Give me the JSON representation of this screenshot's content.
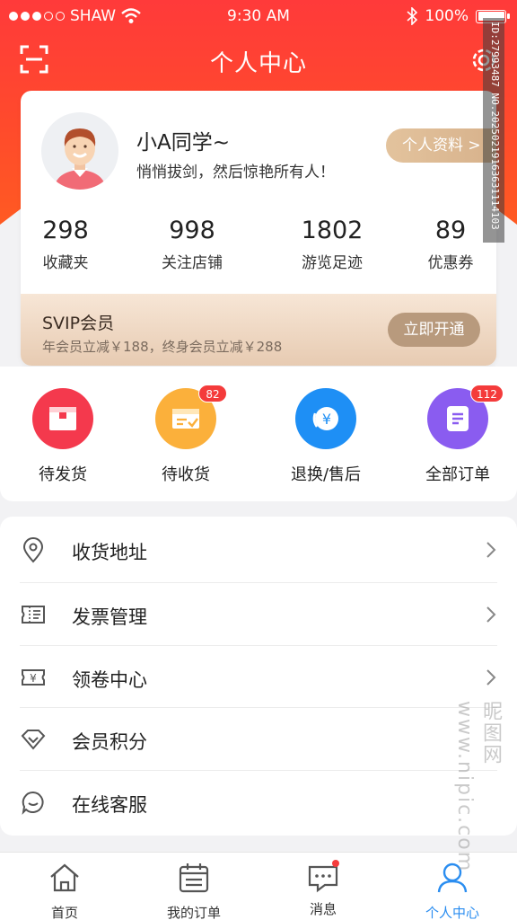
{
  "status_bar": {
    "carrier": "SHAW",
    "time": "9:30 AM",
    "battery": "100%"
  },
  "navbar": {
    "title": "个人中心"
  },
  "profile": {
    "name": "小A同学~",
    "motto": "悄悄拔剑，然后惊艳所有人！",
    "profile_button": "个人资料 >",
    "stats": [
      {
        "value": "298",
        "label": "收藏夹"
      },
      {
        "value": "998",
        "label": "关注店铺"
      },
      {
        "value": "1802",
        "label": "游览足迹"
      },
      {
        "value": "89",
        "label": "优惠券"
      }
    ]
  },
  "svip": {
    "title": "SVIP会员",
    "desc": "年会员立减￥188，终身会员立减￥288",
    "button": "立即开通"
  },
  "orders": [
    {
      "label": "待发货",
      "color": "#f4394d",
      "icon": "box-icon",
      "badge": ""
    },
    {
      "label": "待收货",
      "color": "#fbb03b",
      "icon": "package-check-icon",
      "badge": "82"
    },
    {
      "label": "退换/售后",
      "color": "#1e8ff5",
      "icon": "refund-yen-icon",
      "badge": ""
    },
    {
      "label": "全部订单",
      "color": "#8a5cf0",
      "icon": "order-list-icon",
      "badge": "112"
    }
  ],
  "menu": [
    {
      "label": "收货地址",
      "icon": "location-pin-icon"
    },
    {
      "label": "发票管理",
      "icon": "invoice-icon"
    },
    {
      "label": "领卷中心",
      "icon": "coupon-icon"
    },
    {
      "label": "会员积分",
      "icon": "diamond-icon"
    },
    {
      "label": "在线客服",
      "icon": "chat-icon"
    }
  ],
  "tabbar": [
    {
      "label": "首页",
      "icon": "home-icon"
    },
    {
      "label": "我的订单",
      "icon": "calendar-icon"
    },
    {
      "label": "消息",
      "icon": "message-icon"
    },
    {
      "label": "个人中心",
      "icon": "person-icon",
      "active": true
    }
  ],
  "watermark": {
    "id_text": "ID:27993487 NO.20250219163631114103",
    "site_text": "昵图网 www.nipic.com"
  }
}
